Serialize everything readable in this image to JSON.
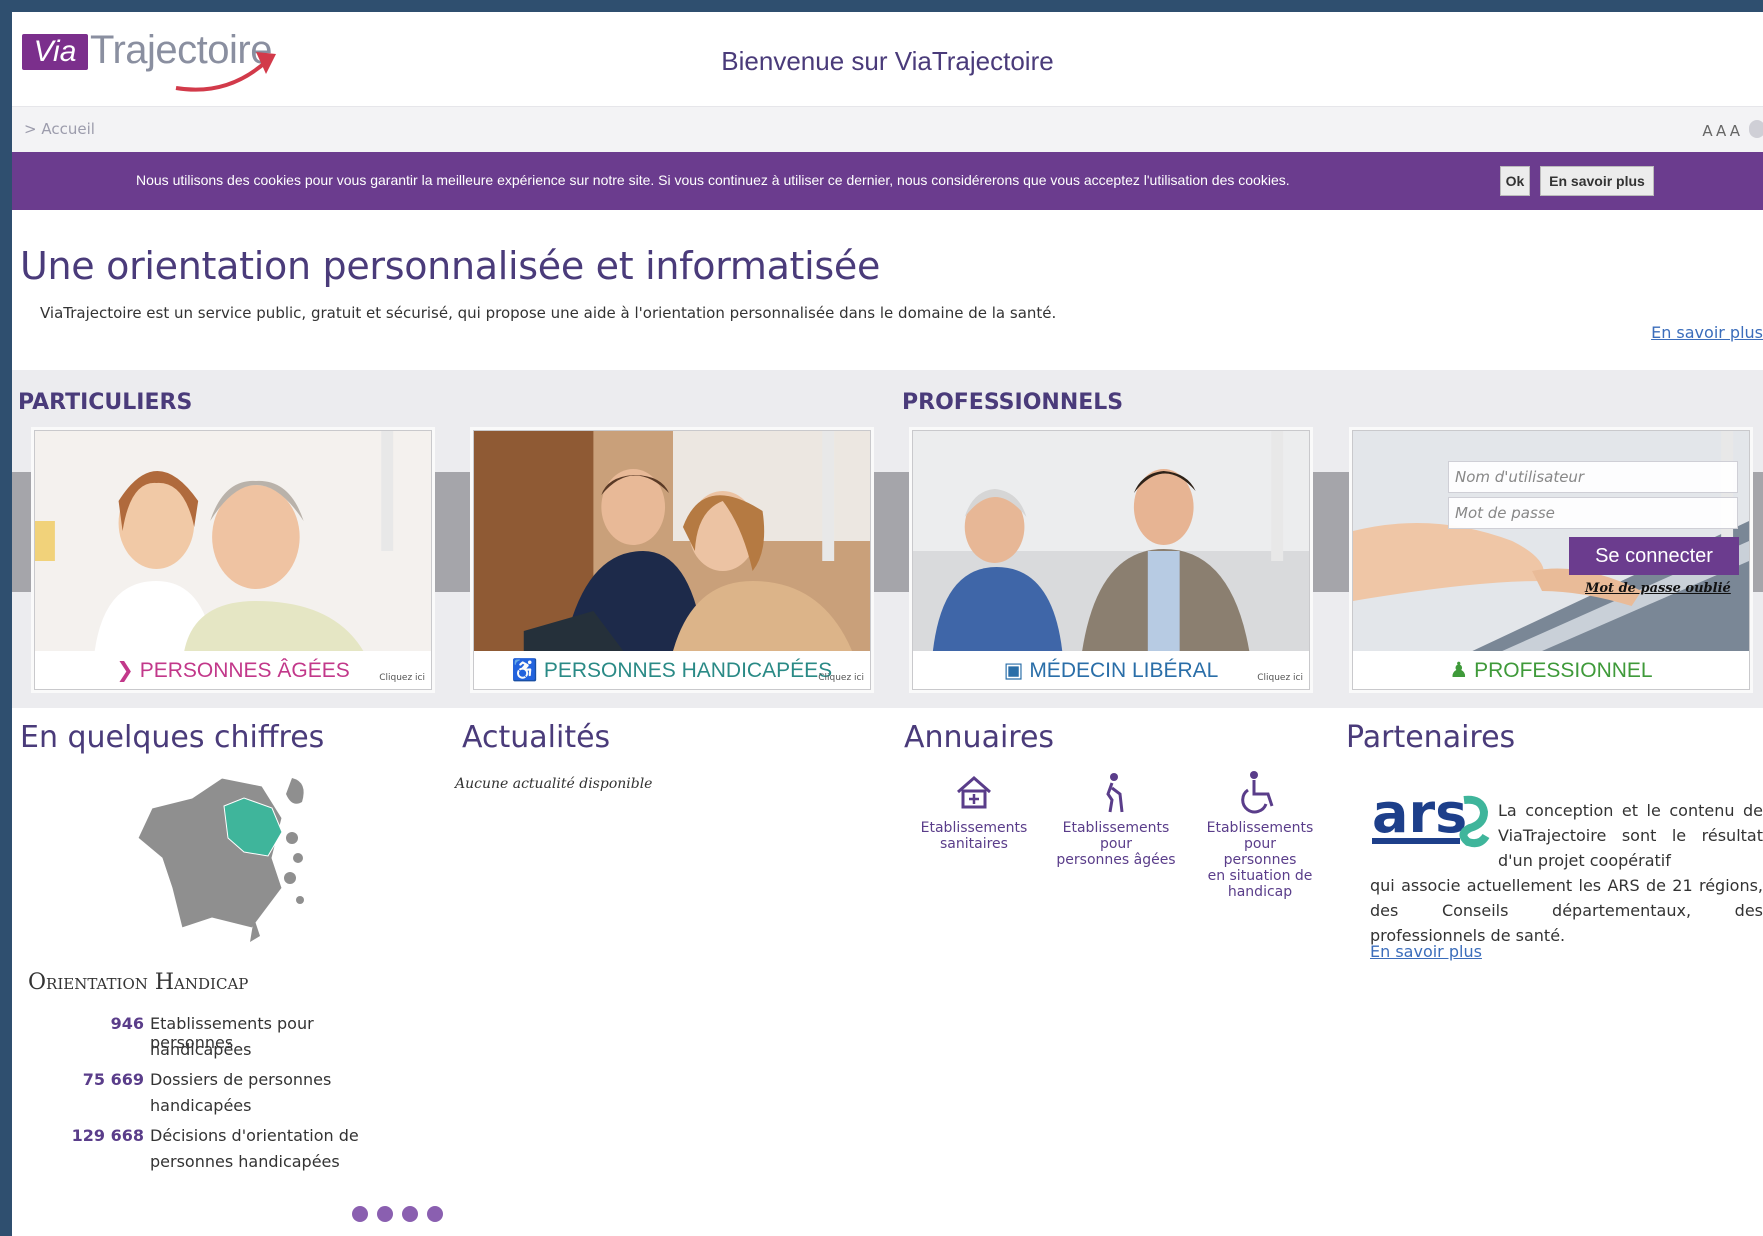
{
  "header": {
    "logo_via": "Via",
    "logo_trajectoire": "Trajectoire",
    "welcome": "Bienvenue sur ViaTrajectoire"
  },
  "breadcrumb": {
    "label": "> Accueil"
  },
  "font_size_control": "AAA",
  "cookie_banner": {
    "text": "Nous utilisons des cookies pour vous garantir la meilleure expérience sur notre site. Si vous continuez à utiliser ce dernier, nous considérerons que vous acceptez l'utilisation des cookies.",
    "ok_label": "Ok",
    "more_label": "En savoir plus"
  },
  "intro": {
    "title": "Une orientation personnalisée et informatisée",
    "text": "ViaTrajectoire est un service public, gratuit et sécurisé, qui propose une aide à l'orientation personnalisée dans le domaine de la santé.",
    "more_link": "En savoir plus"
  },
  "sections": {
    "particuliers": "PARTICULIERS",
    "professionnels": "PROFESSIONNELS"
  },
  "cards": [
    {
      "label": "PERSONNES ÂGÉES",
      "icon": "elderly-icon",
      "click": "Cliquez ici",
      "color": "#c2388a"
    },
    {
      "label": "PERSONNES HANDICAPÉES",
      "icon": "wheelchair-icon",
      "click": "Cliquez ici",
      "color": "#2a8a86"
    },
    {
      "label": "MÉDECIN LIBÉRAL",
      "icon": "briefcase-icon",
      "click": "Cliquez ici",
      "color": "#2a6ea8"
    },
    {
      "label": "PROFESSIONNEL",
      "icon": "user-icon",
      "color": "#3f9a3a"
    }
  ],
  "login": {
    "username_placeholder": "Nom d'utilisateur",
    "password_placeholder": "Mot de passe",
    "connect_label": "Se connecter",
    "forgot_label": "Mot de passe oublié"
  },
  "chiffres": {
    "title": "En quelques chiffres",
    "subtitle": "Orientation Handicap",
    "stats": [
      {
        "value": "946",
        "line1": "Etablissements pour personnes",
        "line2": "handicapées"
      },
      {
        "value": "75 669",
        "line1": "Dossiers de personnes",
        "line2": "handicapées"
      },
      {
        "value": "129 668",
        "line1": "Décisions d'orientation de",
        "line2": "personnes handicapées"
      }
    ]
  },
  "actualites": {
    "title": "Actualités",
    "empty": "Aucune actualité disponible"
  },
  "annuaires": {
    "title": "Annuaires",
    "items": [
      {
        "lines": [
          "Etablissements",
          "sanitaires"
        ],
        "icon": "house-icon"
      },
      {
        "lines": [
          "Etablissements",
          "pour",
          "personnes âgées"
        ],
        "icon": "elderly-icon"
      },
      {
        "lines": [
          "Etablissements",
          "pour",
          "personnes",
          "en situation de",
          "handicap"
        ],
        "icon": "wheelchair-icon"
      }
    ]
  },
  "partenaires": {
    "title": "Partenaires",
    "logo_text": "ars",
    "text_indent": "La conception et le contenu de ViaTrajectoire sont le résultat d'un projet coopératif",
    "text_rest": "qui associe actuellement les ARS de 21 régions, des Conseils départementaux, des professionnels de santé.",
    "more_link": "En savoir plus"
  },
  "colors": {
    "brand_purple": "#6b3c8e",
    "title_purple": "#4a3b7a",
    "link_blue": "#3b6dbb"
  },
  "carousel": {
    "dots": 4
  }
}
